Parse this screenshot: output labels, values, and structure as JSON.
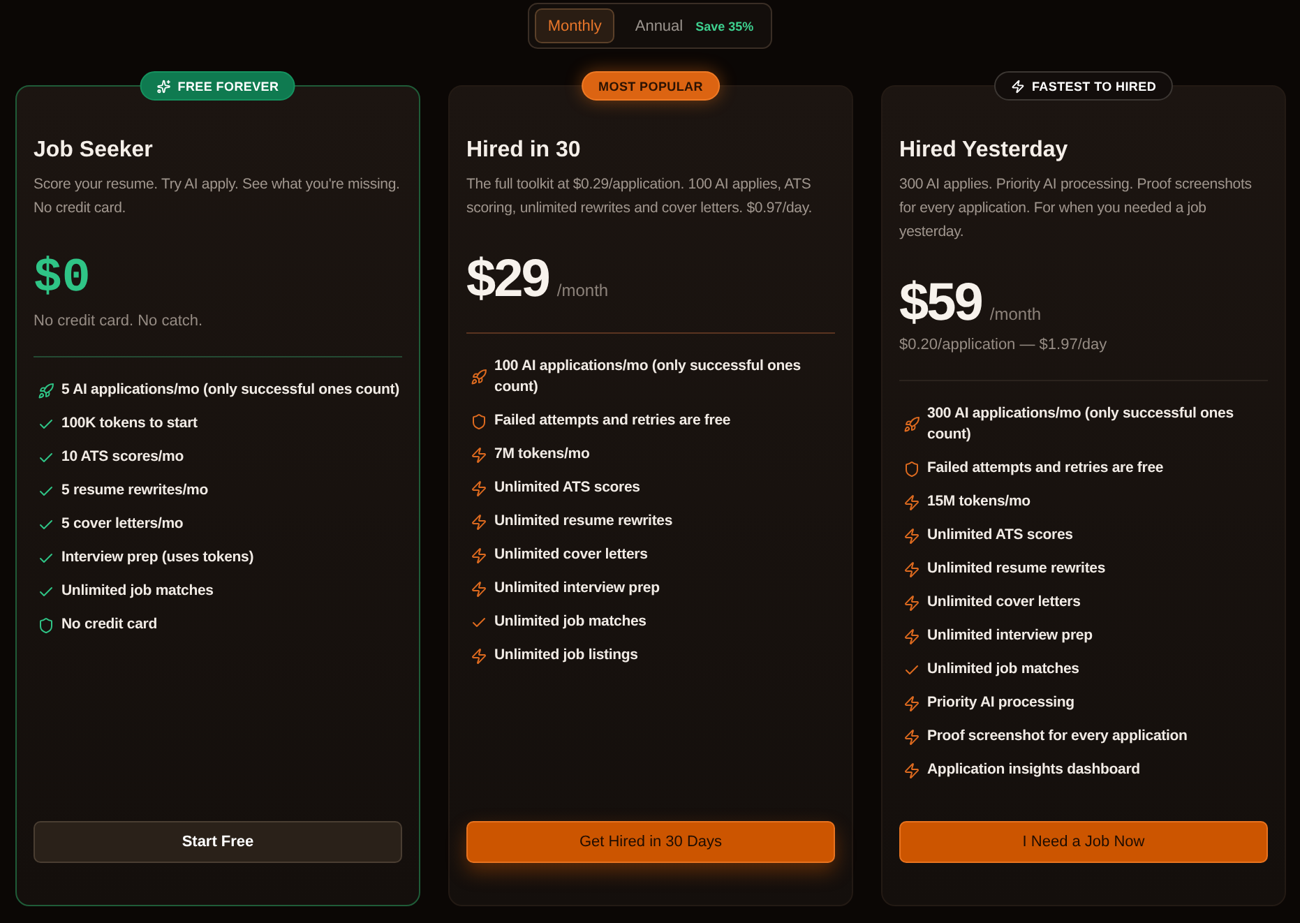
{
  "billing": {
    "options": [
      {
        "label": "Monthly",
        "selected": true
      },
      {
        "label": "Annual",
        "selected": false,
        "tag": "Save 35%"
      }
    ]
  },
  "plans": [
    {
      "kind": "free",
      "highlighted": false,
      "badge": {
        "kind": "free",
        "label": "FREE FOREVER"
      },
      "name": "Job Seeker",
      "description": "Score your resume. Try AI apply. See what you're missing. No credit card.",
      "price": "$0",
      "note": "No credit card. No catch.",
      "features": [
        {
          "kind": "rocket",
          "text": "5 AI applications/mo (only successful ones count)"
        },
        {
          "kind": "check",
          "text": "100K tokens to start"
        },
        {
          "kind": "check",
          "text": "10 ATS scores/mo"
        },
        {
          "kind": "check",
          "text": "5 resume rewrites/mo"
        },
        {
          "kind": "check",
          "text": "5 cover letters/mo"
        },
        {
          "kind": "check",
          "text": "Interview prep (uses tokens)"
        },
        {
          "kind": "check",
          "text": "Unlimited job matches"
        },
        {
          "kind": "shield",
          "text": "No credit card"
        }
      ],
      "button": "Start Free"
    },
    {
      "kind": "paid",
      "highlighted": true,
      "badge": {
        "kind": "popular",
        "label": "MOST POPULAR"
      },
      "name": "Hired in 30",
      "description": "The full toolkit at $0.29/application. 100 AI applies, ATS scoring, unlimited rewrites and cover letters. $0.97/day.",
      "price": "$29",
      "period": "/month",
      "features": [
        {
          "kind": "rocket",
          "text": "100 AI applications/mo (only successful ones count)"
        },
        {
          "kind": "shield",
          "text": "Failed attempts and retries are free"
        },
        {
          "kind": "bolt",
          "text": "7M tokens/mo"
        },
        {
          "kind": "bolt",
          "text": "Unlimited ATS scores"
        },
        {
          "kind": "bolt",
          "text": "Unlimited resume rewrites"
        },
        {
          "kind": "bolt",
          "text": "Unlimited cover letters"
        },
        {
          "kind": "bolt",
          "text": "Unlimited interview prep"
        },
        {
          "kind": "check",
          "text": "Unlimited job matches"
        },
        {
          "kind": "bolt",
          "text": "Unlimited job listings"
        }
      ],
      "button": "Get Hired in 30 Days"
    },
    {
      "kind": "paid",
      "highlighted": false,
      "badge": {
        "kind": "fastest",
        "label": "FASTEST TO HIRED"
      },
      "name": "Hired Yesterday",
      "description": "300 AI applies. Priority AI processing. Proof screenshots for every application. For when you needed a job yesterday.",
      "price": "$59",
      "period": "/month",
      "note": "$0.20/application — $1.97/day",
      "features": [
        {
          "kind": "rocket",
          "text": "300 AI applications/mo (only successful ones count)"
        },
        {
          "kind": "shield",
          "text": "Failed attempts and retries are free"
        },
        {
          "kind": "bolt",
          "text": "15M tokens/mo"
        },
        {
          "kind": "bolt",
          "text": "Unlimited ATS scores"
        },
        {
          "kind": "bolt",
          "text": "Unlimited resume rewrites"
        },
        {
          "kind": "bolt",
          "text": "Unlimited cover letters"
        },
        {
          "kind": "bolt",
          "text": "Unlimited interview prep"
        },
        {
          "kind": "check",
          "text": "Unlimited job matches"
        },
        {
          "kind": "bolt",
          "text": "Priority AI processing"
        },
        {
          "kind": "bolt",
          "text": "Proof screenshot for every application"
        },
        {
          "kind": "bolt",
          "text": "Application insights dashboard"
        }
      ],
      "button": "I Need a Job Now"
    }
  ]
}
